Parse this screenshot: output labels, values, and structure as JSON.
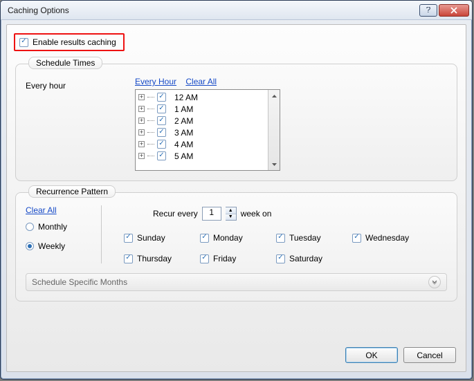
{
  "window": {
    "title": "Caching Options"
  },
  "enable": {
    "label": "Enable results caching",
    "checked": true
  },
  "schedule": {
    "legend": "Schedule Times",
    "summary": "Every hour",
    "links": {
      "everyHour": "Every Hour",
      "clearAll": "Clear All"
    },
    "hours": [
      {
        "label": "12 AM",
        "checked": true
      },
      {
        "label": "1 AM",
        "checked": true
      },
      {
        "label": "2 AM",
        "checked": true
      },
      {
        "label": "3 AM",
        "checked": true
      },
      {
        "label": "4 AM",
        "checked": true
      },
      {
        "label": "5 AM",
        "checked": true
      }
    ]
  },
  "recurrence": {
    "legend": "Recurrence Pattern",
    "clearAll": "Clear All",
    "modes": {
      "monthly": "Monthly",
      "weekly": "Weekly",
      "selected": "weekly"
    },
    "recur": {
      "prefix": "Recur every",
      "value": "1",
      "suffix": "week on"
    },
    "days": [
      {
        "label": "Sunday",
        "checked": true
      },
      {
        "label": "Monday",
        "checked": true
      },
      {
        "label": "Tuesday",
        "checked": true
      },
      {
        "label": "Wednesday",
        "checked": true
      },
      {
        "label": "Thursday",
        "checked": true
      },
      {
        "label": "Friday",
        "checked": true
      },
      {
        "label": "Saturday",
        "checked": true
      }
    ]
  },
  "expander": {
    "label": "Schedule Specific Months"
  },
  "buttons": {
    "ok": "OK",
    "cancel": "Cancel"
  }
}
